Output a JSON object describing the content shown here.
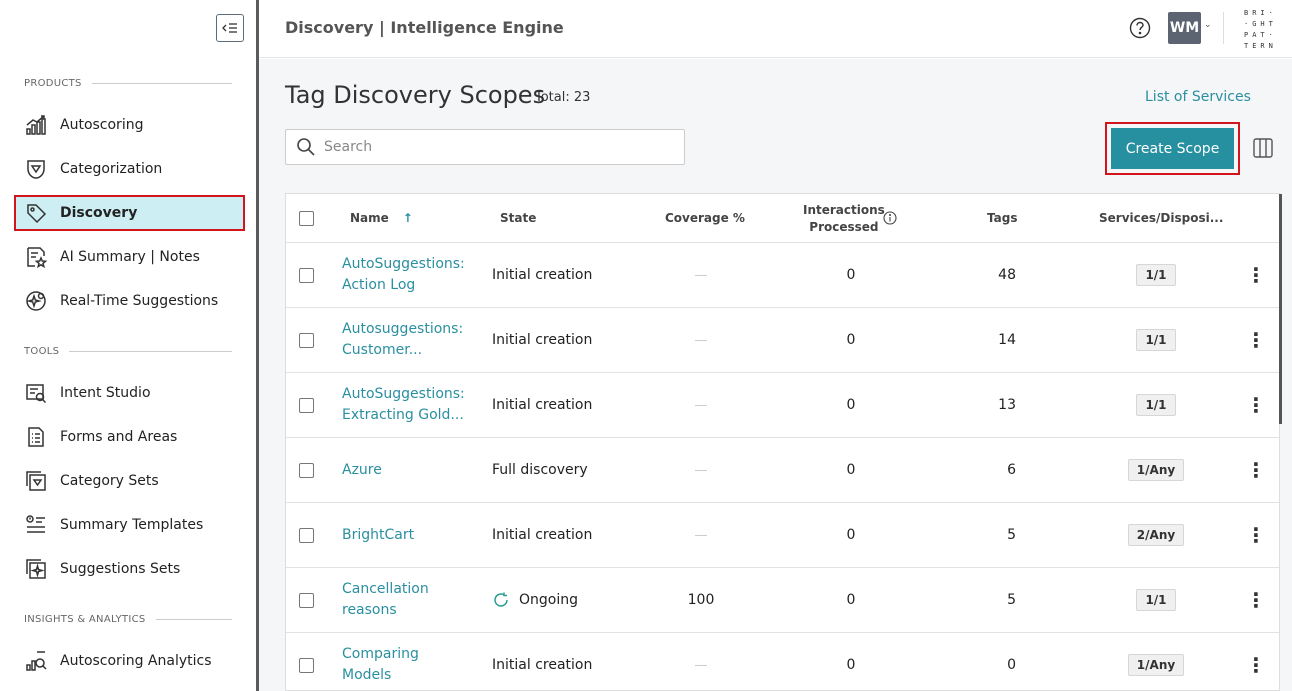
{
  "header": {
    "title": "Discovery | Intelligence Engine",
    "avatar_initials": "WM",
    "logo_text": "BRI·\n·GHT\nPAT·\nTERN"
  },
  "sidebar": {
    "sections": [
      {
        "label": "PRODUCTS"
      },
      {
        "label": "TOOLS"
      },
      {
        "label": "INSIGHTS & ANALYTICS"
      }
    ],
    "items": [
      {
        "label": "Autoscoring",
        "icon": "autoscoring-icon"
      },
      {
        "label": "Categorization",
        "icon": "categorization-icon"
      },
      {
        "label": "Discovery",
        "icon": "tag-icon",
        "active": true
      },
      {
        "label": "AI Summary | Notes",
        "icon": "ai-summary-icon"
      },
      {
        "label": "Real-Time Suggestions",
        "icon": "suggestions-icon"
      },
      {
        "label": "Intent Studio",
        "icon": "intent-studio-icon"
      },
      {
        "label": "Forms and Areas",
        "icon": "forms-icon"
      },
      {
        "label": "Category Sets",
        "icon": "category-sets-icon"
      },
      {
        "label": "Summary Templates",
        "icon": "summary-templates-icon"
      },
      {
        "label": "Suggestions Sets",
        "icon": "suggestions-sets-icon"
      },
      {
        "label": "Autoscoring Analytics",
        "icon": "analytics-icon"
      }
    ]
  },
  "main": {
    "title": "Tag Discovery Scopes",
    "total": "Total: 23",
    "list_services": "List of Services",
    "search_placeholder": "Search",
    "create_label": "Create Scope",
    "columns": {
      "name": "Name",
      "state": "State",
      "coverage": "Coverage %",
      "interactions_1": "Interactions",
      "interactions_2": "Processed",
      "tags": "Tags",
      "services": "Services/Disposi..."
    },
    "rows": [
      {
        "name1": "AutoSuggestions:",
        "name2": "Action Log",
        "state": "Initial creation",
        "coverage": "",
        "interactions": "0",
        "tags": "48",
        "services": "1/1"
      },
      {
        "name1": "Autosuggestions:",
        "name2": "Customer...",
        "state": "Initial creation",
        "coverage": "",
        "interactions": "0",
        "tags": "14",
        "services": "1/1"
      },
      {
        "name1": "AutoSuggestions:",
        "name2": "Extracting Gold...",
        "state": "Initial creation",
        "coverage": "",
        "interactions": "0",
        "tags": "13",
        "services": "1/1"
      },
      {
        "name1": "Azure",
        "name2": "",
        "state": "Full discovery",
        "coverage": "",
        "interactions": "0",
        "tags": "6",
        "services": "1/Any"
      },
      {
        "name1": "BrightCart",
        "name2": "",
        "state": "Initial creation",
        "coverage": "",
        "interactions": "0",
        "tags": "5",
        "services": "2/Any"
      },
      {
        "name1": "Cancellation",
        "name2": "reasons",
        "state": "Ongoing",
        "coverage": "100",
        "interactions": "0",
        "tags": "5",
        "services": "1/1"
      },
      {
        "name1": "Comparing",
        "name2": "Models",
        "state": "Initial creation",
        "coverage": "",
        "interactions": "0",
        "tags": "0",
        "services": "1/Any"
      }
    ]
  }
}
